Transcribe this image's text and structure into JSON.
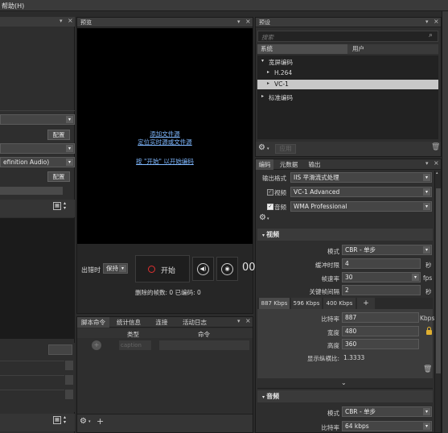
{
  "menubar": {
    "help": "帮助(H)"
  },
  "left": {
    "config1": "配置",
    "combo_text": "efinition Audio)",
    "config2": "配置"
  },
  "preview": {
    "title": "预览",
    "add_file": "添加文件源",
    "locate_live": "定位实时源或文件源",
    "press_start": "按 \"开始\" 以开始编码",
    "on_error_label": "出错时",
    "on_error_value": "保持",
    "start": "开始",
    "status": "删除的帧数: 0 已编码: 0",
    "right_fragment": "00"
  },
  "bottom": {
    "tabs": [
      "脚本命令",
      "统计信息",
      "连接",
      "活动日志"
    ],
    "col_type": "类型",
    "col_cmd": "命令",
    "row_type": "caption"
  },
  "presets": {
    "title": "预设",
    "search_placeholder": "搜索",
    "tabs": [
      "系统",
      "用户"
    ],
    "tree": [
      {
        "label": "宽屏编码",
        "level": 0
      },
      {
        "label": "H.264",
        "level": 1
      },
      {
        "label": "VC-1",
        "level": 1,
        "selected": true
      },
      {
        "label": "标准编码",
        "level": 0
      }
    ],
    "apply": "应用"
  },
  "encode": {
    "tabs": [
      "编码",
      "元数据",
      "输出"
    ],
    "output_format_label": "输出格式",
    "output_format_value": "IIS 平滑流式处理",
    "video_label": "视频",
    "video_value": "VC-1 Advanced",
    "audio_label": "音频",
    "audio_value": "WMA Professional",
    "video_section": "视频",
    "mode_label": "模式",
    "mode_value": "CBR - 单步",
    "buffer_label": "缓冲时限",
    "buffer_value": "4",
    "buffer_unit": "秒",
    "framerate_label": "帧速率",
    "framerate_value": "30",
    "framerate_unit": "fps",
    "keyframe_label": "关键帧间隔",
    "keyframe_value": "2",
    "keyframe_unit": "秒",
    "bitrate_tabs": [
      "887 Kbps",
      "596 Kbps",
      "400 Kbps",
      "+"
    ],
    "bitrate_label": "比特率",
    "bitrate_value": "887",
    "bitrate_unit": "Kbps",
    "width_label": "宽度",
    "width_value": "480",
    "height_label": "高度",
    "height_value": "360",
    "aspect_label": "显示纵横比:",
    "aspect_value": "1.3333",
    "audio_section": "音频",
    "audio_mode_label": "模式",
    "audio_mode_value": "CBR - 单步",
    "audio_bitrate_label": "比特率",
    "audio_bitrate_value": "64 kbps"
  }
}
